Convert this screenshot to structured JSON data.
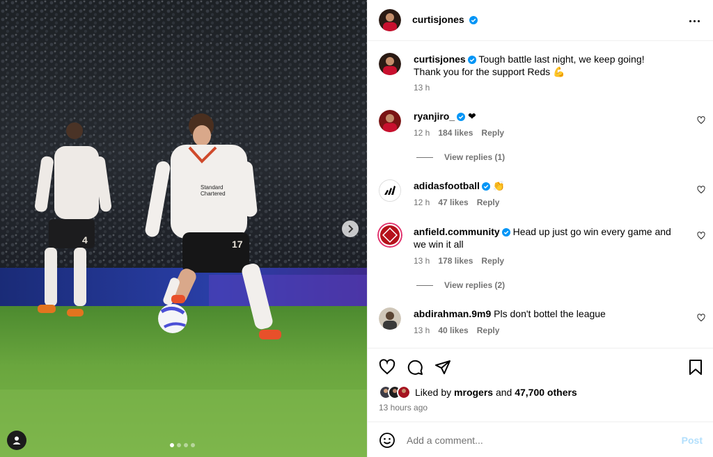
{
  "post": {
    "author": "curtisjones",
    "caption_text": "Tough battle last night, we keep going!",
    "caption_text_2": "Thank you for the support Reds 💪",
    "caption_time": "13 h"
  },
  "comments": [
    {
      "user": "ryanjiro_",
      "text": "❤",
      "time": "12 h",
      "likes": "184 likes",
      "reply": "Reply",
      "view_replies": "View replies (1)"
    },
    {
      "user": "adidasfootball",
      "text": "👏",
      "time": "12 h",
      "likes": "47 likes",
      "reply": "Reply"
    },
    {
      "user": "anfield.community",
      "text": "Head up just go win every game and",
      "text_2": "we win it all",
      "time": "13 h",
      "likes": "178 likes",
      "reply": "Reply",
      "view_replies": "View replies (2)"
    },
    {
      "user": "abdirahman.9m9",
      "text": "Pls don't bottel the league",
      "time": "13 h",
      "likes": "40 likes",
      "reply": "Reply"
    }
  ],
  "engagement": {
    "liked_by_prefix": "Liked by",
    "liked_by_user": "mrogers",
    "and_word": "and",
    "others_count": "47,700 others",
    "time_ago": "13 hours ago"
  },
  "composer": {
    "placeholder": "Add a comment...",
    "post_label": "Post"
  },
  "carousel": {
    "slides": 4,
    "active_index": 0
  },
  "icons": {
    "verified": "verified-badge-icon",
    "heart": "heart-icon",
    "comment": "comment-icon",
    "share": "share-icon",
    "save": "bookmark-icon",
    "more": "more-icon",
    "emoji": "emoji-icon",
    "next": "chevron-right-icon",
    "tag": "user-tag-icon"
  },
  "colors": {
    "verified_blue": "#0095f6",
    "muted_text": "#737373",
    "post_disabled": "#b2dffc",
    "border": "#efefef"
  }
}
